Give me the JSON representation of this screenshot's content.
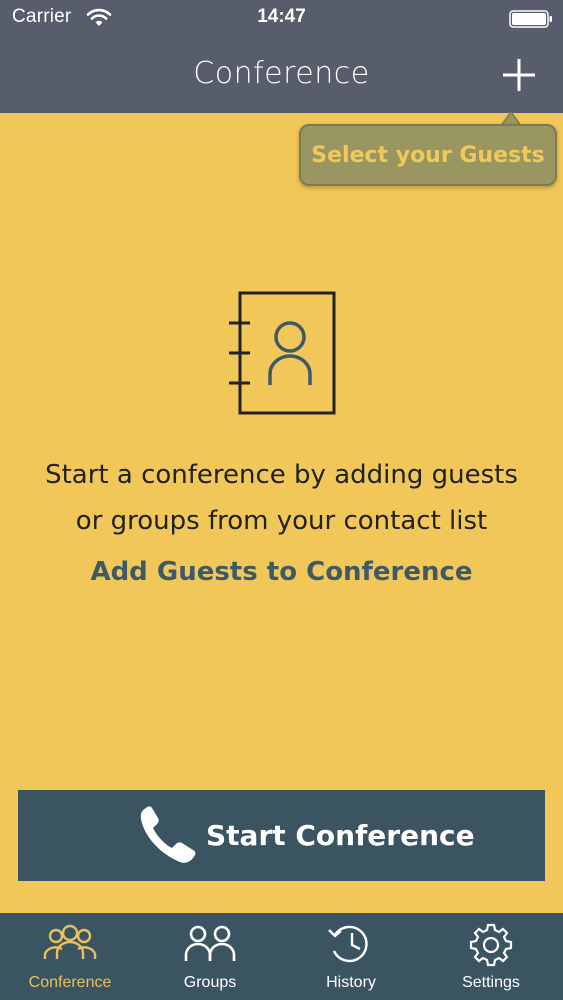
{
  "status_bar": {
    "carrier": "Carrier",
    "time": "14:47",
    "wifi_icon": "wifi-icon",
    "battery_icon": "battery-icon"
  },
  "nav": {
    "title": "Conference",
    "add_icon": "plus-icon"
  },
  "tooltip": {
    "text": "Select your Guests"
  },
  "empty_state": {
    "icon": "contact-book-icon",
    "line1": "Start a conference by adding guests",
    "line2": "or groups from your contact list",
    "link": "Add Guests to Conference"
  },
  "start_button": {
    "label": "Start Conference",
    "icon": "phone-icon"
  },
  "tabs": [
    {
      "label": "Conference",
      "icon": "conference-icon",
      "active": true
    },
    {
      "label": "Groups",
      "icon": "groups-icon",
      "active": false
    },
    {
      "label": "History",
      "icon": "history-icon",
      "active": false
    },
    {
      "label": "Settings",
      "icon": "gear-icon",
      "active": false
    }
  ],
  "colors": {
    "background": "#f2c75a",
    "header": "#575d6a",
    "primary_dark": "#3a5462",
    "accent": "#e9c15c",
    "link": "#3e5a66"
  }
}
